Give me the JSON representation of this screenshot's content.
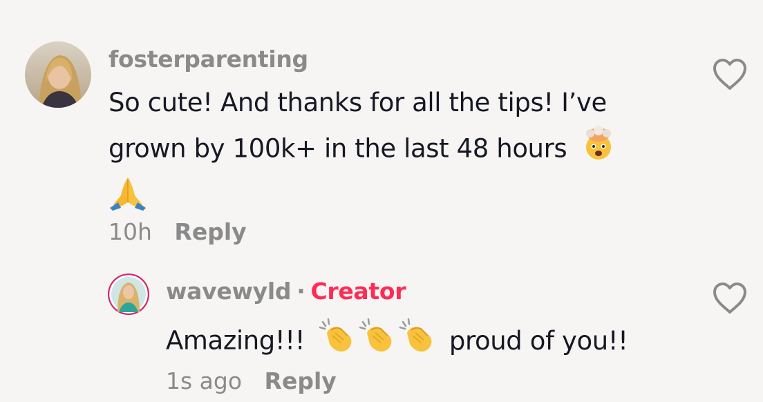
{
  "comments": [
    {
      "username": "fosterparenting",
      "text_line1": "So cute! And thanks for all the tips! I’ve",
      "text_line2": "grown by 100k+ in the last 48 hours",
      "emoji_after_line2": "exploding-head-emoji",
      "emoji_line3": "folded-hands-emoji",
      "time": "10h",
      "reply_label": "Reply",
      "like_icon": "heart-outline-icon"
    },
    {
      "username": "wavewyld",
      "separator": "·",
      "badge": "Creator",
      "text_before": "Amazing!!!",
      "emojis": [
        "clapping-hands-emoji",
        "clapping-hands-emoji",
        "clapping-hands-emoji"
      ],
      "text_after": "proud of you!!",
      "time": "1s ago",
      "reply_label": "Reply",
      "like_icon": "heart-outline-icon"
    }
  ],
  "colors": {
    "background": "#f6f5f4",
    "username": "#8a8a8a",
    "text": "#161823",
    "creator_badge": "#fe2c55",
    "heart": "#8a8a8a"
  }
}
